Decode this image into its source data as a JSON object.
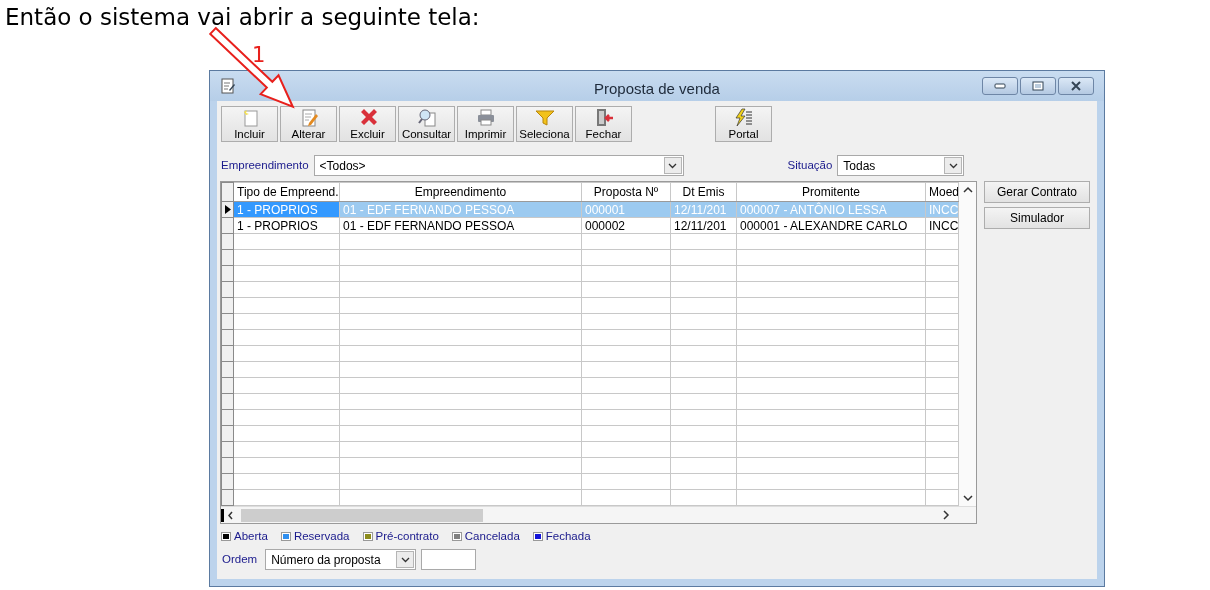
{
  "caption": "Então o sistema vai abrir a seguinte tela:",
  "annotation": {
    "label": "1"
  },
  "window": {
    "title": "Proposta de venda"
  },
  "toolbar": [
    {
      "label": "Incluir",
      "kind": "new"
    },
    {
      "label": "Alterar",
      "kind": "edit"
    },
    {
      "label": "Excluir",
      "kind": "delete"
    },
    {
      "label": "Consultar",
      "kind": "search"
    },
    {
      "label": "Imprimir",
      "kind": "print"
    },
    {
      "label": "Seleciona",
      "kind": "filter"
    },
    {
      "label": "Fechar",
      "kind": "exit"
    },
    {
      "label": "Portal",
      "kind": "portal"
    }
  ],
  "filters": [
    {
      "label": "Empreendimento",
      "value": "<Todos>"
    },
    {
      "label": "Situação",
      "value": "Todas"
    }
  ],
  "table": {
    "columns": [
      "Tipo de Empreend.",
      "Empreendimento",
      "Proposta Nº",
      "Dt Emis",
      "Promitente",
      "Moed"
    ],
    "rows": [
      {
        "selected": true,
        "cells": [
          "1 - PROPRIOS",
          "01 - EDF FERNANDO PESSOA",
          "000001",
          "12/11/201",
          "000007 - ANTÔNIO LESSA",
          "INCC"
        ]
      },
      {
        "selected": false,
        "cells": [
          "1 - PROPRIOS",
          "01 - EDF FERNANDO PESSOA",
          "000002",
          "12/11/201",
          "000001 - ALEXANDRE CARLO",
          "INCC"
        ]
      }
    ]
  },
  "side_buttons": [
    "Gerar Contrato",
    "Simulador"
  ],
  "legend": [
    {
      "label": "Aberta",
      "color": "#000000"
    },
    {
      "label": "Reservada",
      "color": "#2f8ff0"
    },
    {
      "label": "Pré-contrato",
      "color": "#8c8c1c"
    },
    {
      "label": "Cancelada",
      "color": "#808080"
    },
    {
      "label": "Fechada",
      "color": "#1414d8"
    }
  ],
  "order": {
    "label": "Ordem",
    "value": "Número da proposta"
  }
}
